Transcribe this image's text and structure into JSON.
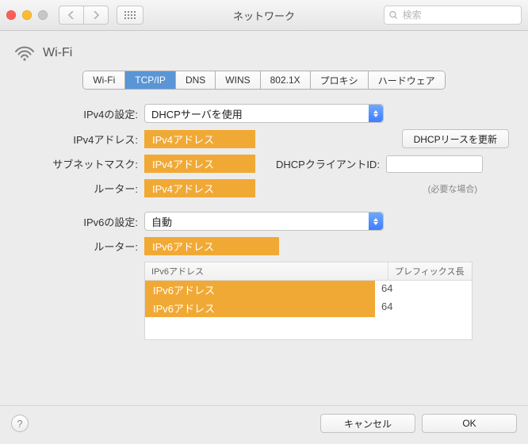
{
  "window": {
    "title": "ネットワーク",
    "search_placeholder": "検索"
  },
  "header": {
    "interface_label": "Wi-Fi"
  },
  "tabs": [
    {
      "label": "Wi-Fi",
      "active": false
    },
    {
      "label": "TCP/IP",
      "active": true
    },
    {
      "label": "DNS",
      "active": false
    },
    {
      "label": "WINS",
      "active": false
    },
    {
      "label": "802.1X",
      "active": false
    },
    {
      "label": "プロキシ",
      "active": false
    },
    {
      "label": "ハードウェア",
      "active": false
    }
  ],
  "labels": {
    "ipv4_config": "IPv4の設定:",
    "ipv4_addr": "IPv4アドレス:",
    "subnet": "サブネットマスク:",
    "router4": "ルーター:",
    "ipv6_config": "IPv6の設定:",
    "router6": "ルーター:",
    "dhcp_client_id": "DHCPクライアントID:",
    "dhcp_hint": "(必要な場合)"
  },
  "values": {
    "ipv4_config_select": "DHCPサーバを使用",
    "ipv4_addr_mask": "IPv4アドレス",
    "subnet_mask": "IPv4アドレス",
    "router4_mask": "IPv4アドレス",
    "ipv6_config_select": "自動",
    "router6_mask": "IPv6アドレス"
  },
  "ipv6_table": {
    "headers": {
      "addr": "IPv6アドレス",
      "prefix": "プレフィックス長"
    },
    "rows": [
      {
        "addr_mask": "IPv6アドレス",
        "prefix": "64"
      },
      {
        "addr_mask": "IPv6アドレス",
        "prefix": "64"
      }
    ]
  },
  "buttons": {
    "dhcp_renew": "DHCPリースを更新",
    "cancel": "キャンセル",
    "ok": "OK"
  }
}
